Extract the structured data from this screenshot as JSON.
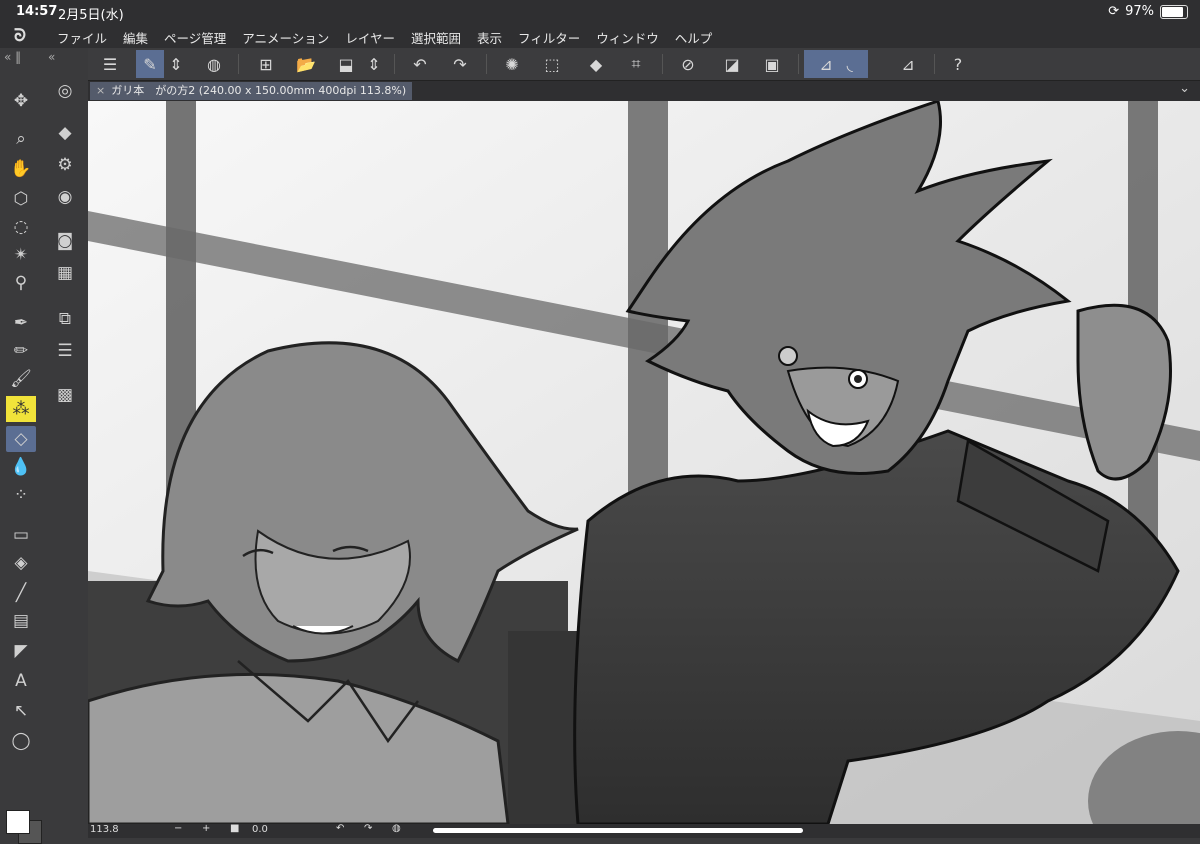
{
  "status": {
    "time": "14:57",
    "date": "2月5日(水)",
    "battery": "97%"
  },
  "menu": {
    "items": [
      "ファイル",
      "編集",
      "ページ管理",
      "アニメーション",
      "レイヤー",
      "選択範囲",
      "表示",
      "フィルター",
      "ウィンドウ",
      "ヘルプ"
    ]
  },
  "tab": {
    "title": "ガリ本　がの方2 (240.00 x 150.00mm 400dpi 113.8%)"
  },
  "bottom": {
    "zoom": "113.8",
    "angle": "0.0"
  },
  "colors": {
    "accent": "#5b6e93",
    "highlight": "#f1e33a"
  }
}
